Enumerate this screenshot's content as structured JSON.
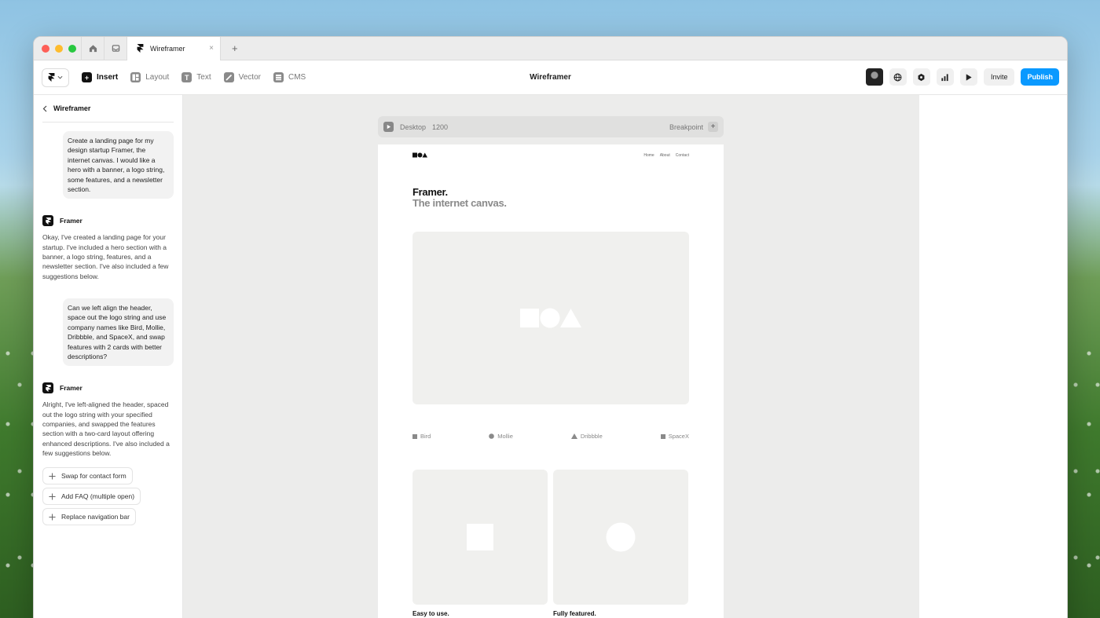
{
  "window": {
    "tab_title": "Wireframer",
    "tab_close": "×",
    "tab_plus": "+"
  },
  "toolbar": {
    "title": "Wireframer",
    "tools": [
      {
        "label": "Insert",
        "icon": "plus-icon"
      },
      {
        "label": "Layout",
        "icon": "layout-icon"
      },
      {
        "label": "Text",
        "icon": "text-icon"
      },
      {
        "label": "Vector",
        "icon": "pen-icon"
      },
      {
        "label": "CMS",
        "icon": "database-icon"
      }
    ],
    "invite_label": "Invite",
    "publish_label": "Publish",
    "accent_color": "#0a99ff"
  },
  "sidebar": {
    "back_title": "Wireframer",
    "conversation": [
      {
        "role": "user",
        "text": "Create a landing page for my design startup Framer, the internet canvas. I would like a hero with a banner, a logo string, some features, and a newsletter section."
      },
      {
        "role": "assistant",
        "name": "Framer",
        "text": "Okay, I've created a landing page for your startup. I've included a hero section with a banner, a logo string, features, and a newsletter section. I've also included a few suggestions below."
      },
      {
        "role": "user",
        "text": "Can we left align the header, space out the logo string and use company names like Bird, Mollie, Dribbble, and SpaceX, and swap features with 2 cards with better descriptions?"
      },
      {
        "role": "assistant",
        "name": "Framer",
        "text": "Alright, I've left-aligned the header, spaced out the logo string with your specified companies, and swapped the features section with a two-card layout offering enhanced descriptions. I've also included a few suggestions below."
      }
    ],
    "suggestions": [
      "Swap for contact form",
      "Add FAQ (multiple open)",
      "Replace navigation bar"
    ]
  },
  "canvas": {
    "breakpoint_name": "Desktop",
    "breakpoint_width": "1200",
    "breakpoint_label": "Breakpoint",
    "breakpoint_plus": "+",
    "page": {
      "nav_links": [
        "Home",
        "About",
        "Contact"
      ],
      "hero_title": "Framer.",
      "hero_subtitle": "The internet canvas.",
      "logos": [
        {
          "name": "Bird",
          "shape": "square"
        },
        {
          "name": "Mollie",
          "shape": "circle"
        },
        {
          "name": "Dribbble",
          "shape": "triangle"
        },
        {
          "name": "SpaceX",
          "shape": "square"
        }
      ],
      "cards": [
        {
          "title": "Easy to use.",
          "shape": "square"
        },
        {
          "title": "Fully featured.",
          "shape": "circle"
        }
      ]
    }
  }
}
